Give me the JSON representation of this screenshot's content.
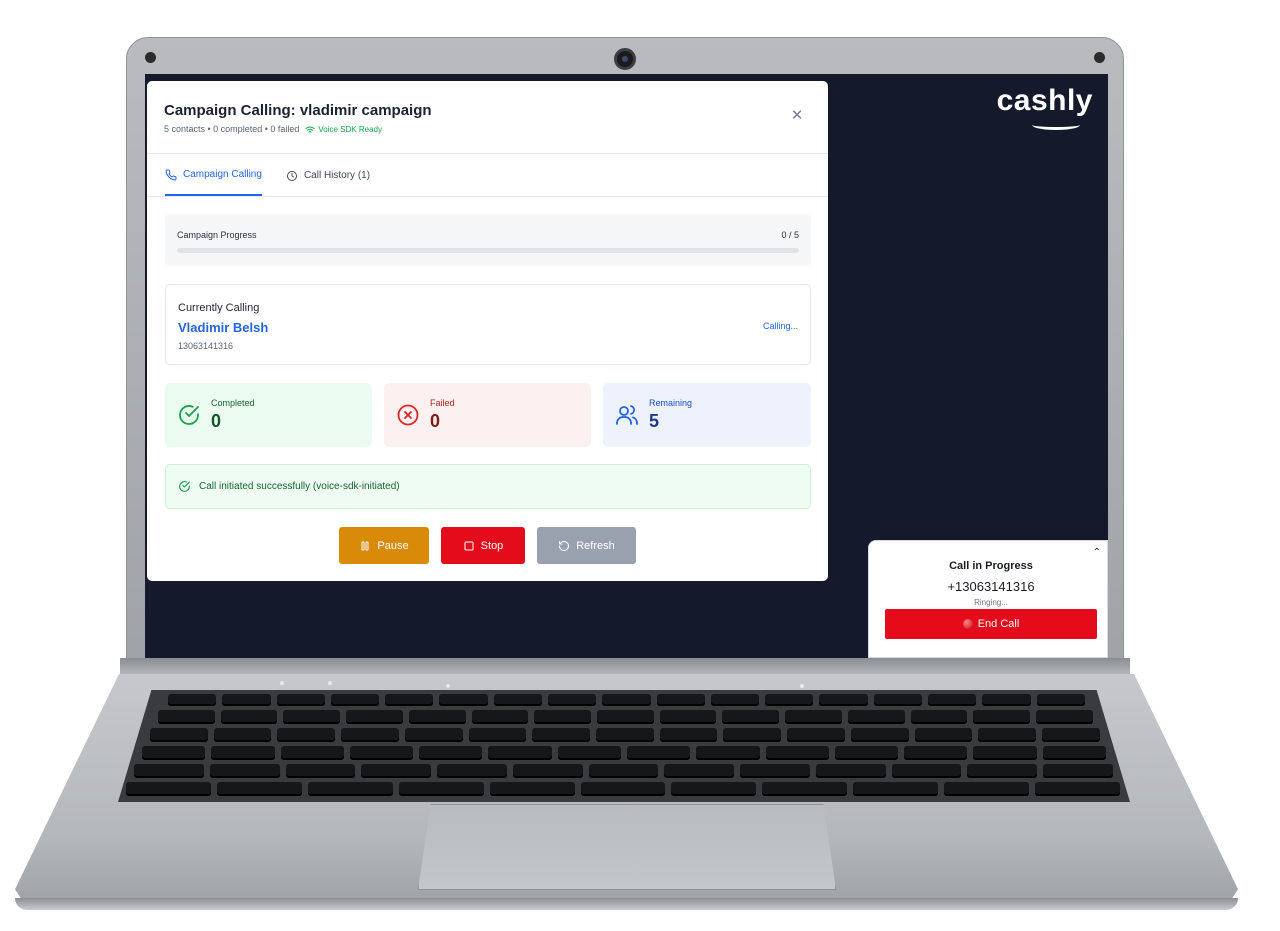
{
  "brand": {
    "name": "cashly"
  },
  "modal": {
    "title": "Campaign Calling: vladimir campaign",
    "subtitle": "5 contacts • 0 completed • 0 failed",
    "sdk_status": "Voice SDK Ready",
    "close_icon": "close-icon"
  },
  "tabs": [
    {
      "label": "Campaign Calling",
      "icon": "phone-icon",
      "active": true
    },
    {
      "label": "Call History (1)",
      "icon": "clock-icon",
      "active": false
    }
  ],
  "progress": {
    "label": "Campaign Progress",
    "count": "0 / 5",
    "fraction": 0
  },
  "current": {
    "label": "Currently Calling",
    "name": "Vladimir Belsh",
    "phone": "13063141316",
    "status": "Calling..."
  },
  "stats": {
    "completed": {
      "label": "Completed",
      "value": "0",
      "icon": "check-circle-icon"
    },
    "failed": {
      "label": "Failed",
      "value": "0",
      "icon": "x-circle-icon"
    },
    "remaining": {
      "label": "Remaining",
      "value": "5",
      "icon": "users-icon"
    }
  },
  "alert": {
    "text": "Call initiated successfully (voice-sdk-initiated)"
  },
  "actions": {
    "pause": "Pause",
    "stop": "Stop",
    "refresh": "Refresh"
  },
  "call_panel": {
    "title": "Call in Progress",
    "number": "+13063141316",
    "status": "Ringing...",
    "end_label": "End Call"
  },
  "colors": {
    "accent": "#2563eb",
    "pause": "#d98a09",
    "stop": "#e40b1b",
    "refresh": "#9aa1ae",
    "success": "#16a34a",
    "screen_bg": "#141a2c"
  }
}
